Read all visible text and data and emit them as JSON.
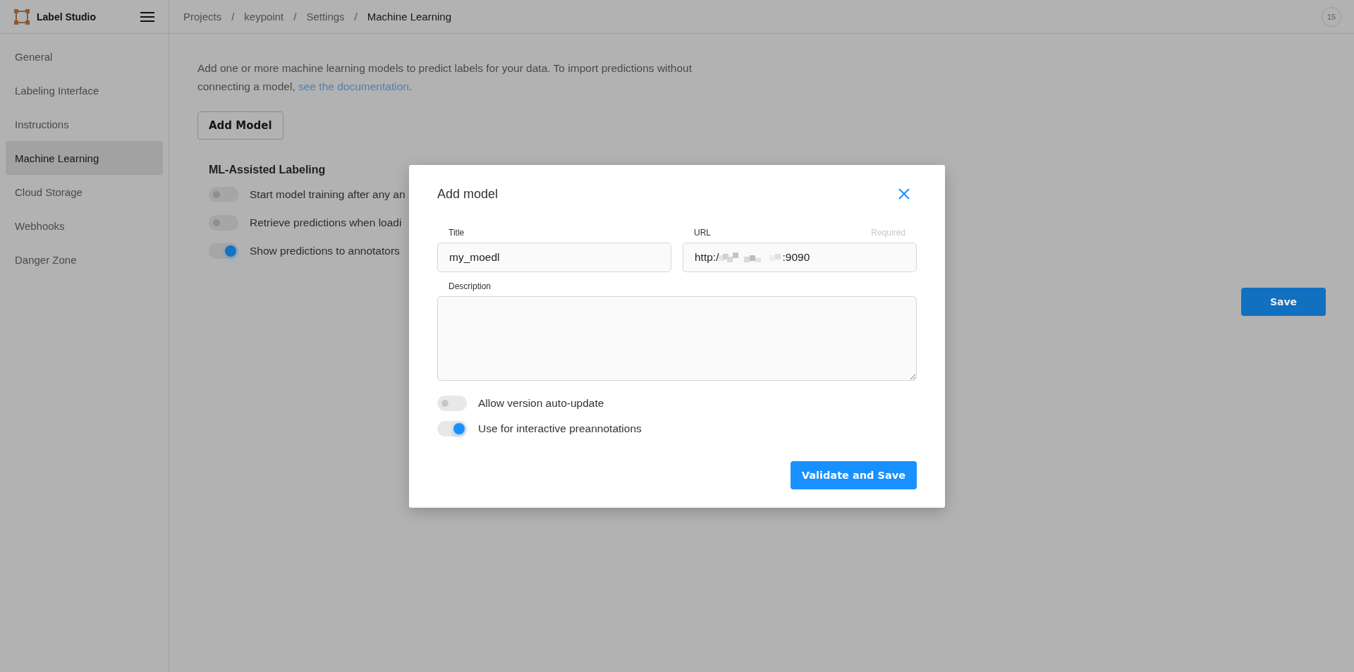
{
  "header": {
    "app_name": "Label Studio",
    "breadcrumbs": [
      {
        "label": "Projects",
        "current": false
      },
      {
        "label": "keypoint",
        "current": false
      },
      {
        "label": "Settings",
        "current": false
      },
      {
        "label": "Machine Learning",
        "current": true
      }
    ],
    "breadcrumb_separator": "/",
    "avatar": "15"
  },
  "sidebar": {
    "items": [
      {
        "label": "General",
        "selected": false
      },
      {
        "label": "Labeling Interface",
        "selected": false
      },
      {
        "label": "Instructions",
        "selected": false
      },
      {
        "label": "Machine Learning",
        "selected": true
      },
      {
        "label": "Cloud Storage",
        "selected": false
      },
      {
        "label": "Webhooks",
        "selected": false
      },
      {
        "label": "Danger Zone",
        "selected": false
      }
    ]
  },
  "main": {
    "intro": "Add one or more machine learning models to predict labels for your data. To import predictions without connecting a model, ",
    "intro_link": "see the documentation",
    "intro_end": ".",
    "add_button": "Add Model",
    "section_title": "ML-Assisted Labeling",
    "toggles": [
      {
        "label": "Start model training after any an",
        "on": false
      },
      {
        "label": "Retrieve predictions when loadi",
        "on": false
      },
      {
        "label": "Show predictions to annotators",
        "on": true
      }
    ],
    "save_button": "Save"
  },
  "modal": {
    "title": "Add model",
    "fields": [
      {
        "label": "Title",
        "value": "my_moedl"
      },
      {
        "label": "URL",
        "required": "Required",
        "value_start": "http:/",
        "value_end": ":9090",
        "redacted": true
      }
    ],
    "description": {
      "label": "Description"
    },
    "toggles": [
      {
        "label": "Allow version auto-update",
        "on": false
      },
      {
        "label": "Use for interactive preannotations",
        "on": true
      }
    ],
    "submit_button": "Validate and Save"
  }
}
